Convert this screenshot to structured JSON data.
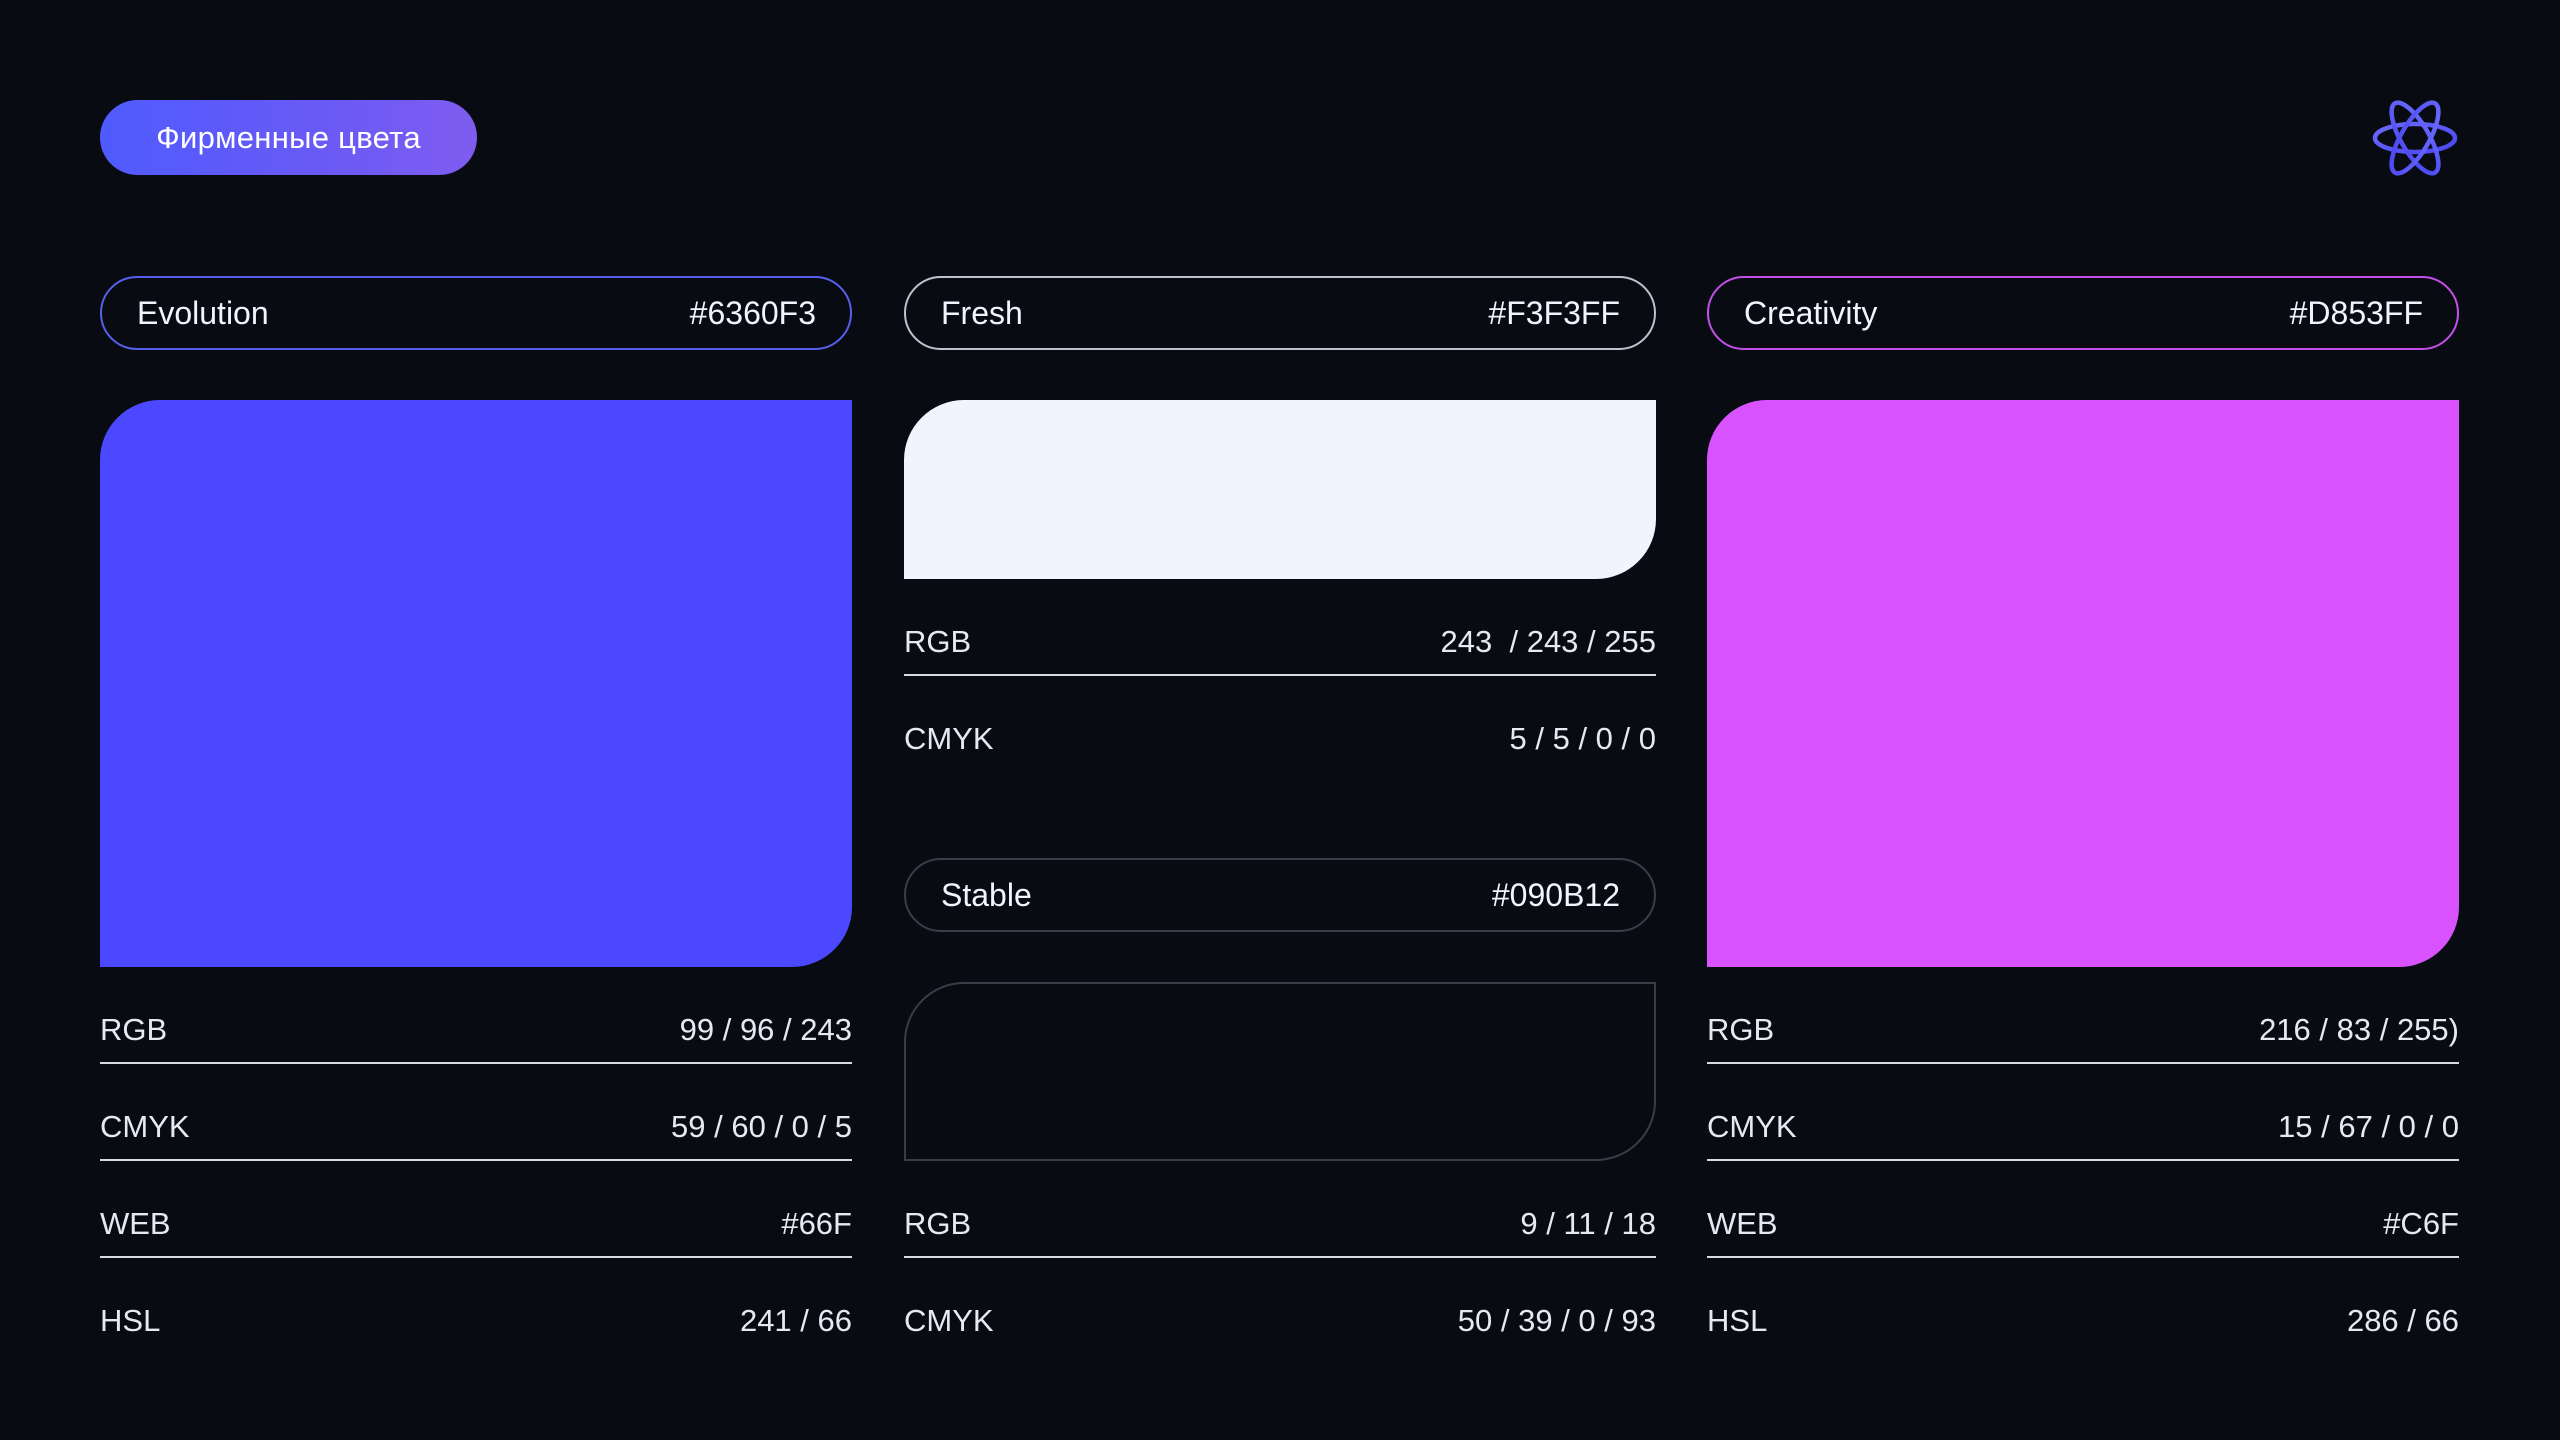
{
  "header": {
    "title": "Фирменные цвета",
    "logo_icon": "atom-icon"
  },
  "colors": {
    "evolution": {
      "name": "Evolution",
      "hex": "#6360F3",
      "swatch": "#4B48FF",
      "specs": [
        {
          "label": "RGB",
          "value": "99 / 96 / 243"
        },
        {
          "label": "CMYK",
          "value": "59 / 60 / 0 / 5"
        },
        {
          "label": "WEB",
          "value": "#66F"
        },
        {
          "label": "HSL",
          "value": "241 / 66"
        }
      ]
    },
    "fresh": {
      "name": "Fresh",
      "hex": "#F3F3FF",
      "swatch": "#F3F3FF",
      "specs": [
        {
          "label": "RGB",
          "value": "243  / 243 / 255"
        },
        {
          "label": "CMYK",
          "value": "5 / 5 / 0 / 0"
        }
      ]
    },
    "stable": {
      "name": "Stable",
      "hex": "#090B12",
      "swatch": "#090B12",
      "specs": [
        {
          "label": "RGB",
          "value": "9 / 11 / 18"
        },
        {
          "label": "CMYK",
          "value": "50 / 39 / 0 / 93"
        }
      ]
    },
    "creativity": {
      "name": "Creativity",
      "hex": "#D853FF",
      "swatch": "#D853FF",
      "specs": [
        {
          "label": "RGB",
          "value": "216 / 83 / 255)"
        },
        {
          "label": "CMYK",
          "value": "15 / 67 / 0 / 0"
        },
        {
          "label": "WEB",
          "value": "#C6F"
        },
        {
          "label": "HSL",
          "value": "286 / 66"
        }
      ]
    }
  }
}
